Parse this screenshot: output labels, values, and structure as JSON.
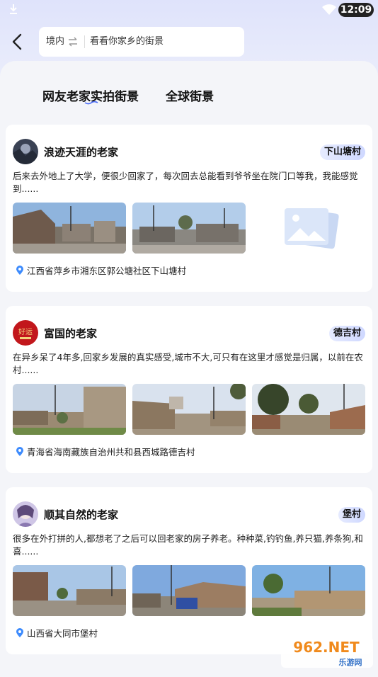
{
  "status_bar": {
    "time": "12:09"
  },
  "search": {
    "region": "境内",
    "query": "看看你家乡的街景"
  },
  "tabs": [
    {
      "label": "网友老家实拍街景"
    },
    {
      "label": "全球街景"
    }
  ],
  "cards": [
    {
      "title": "浪迹天涯的老家",
      "tag": "下山塘村",
      "description": "后来去外地上了大学，便很少回家了，每次回去总能看到爷爷坐在院门口等我，我能感觉到......",
      "location": "江西省萍乡市湘东区郭公塘社区下山塘村",
      "photos": [
        "street-photo",
        "street-photo",
        "placeholder-image-icon"
      ]
    },
    {
      "title": "富国的老家",
      "tag": "德吉村",
      "description": "在异乡呆了4年多,回家乡发展的真实感受,城市不大,可只有在这里才感觉是归属，以前在农村......",
      "location": "青海省海南藏族自治州共和县西城路德吉村",
      "avatar_text": "好运",
      "photos": [
        "street-photo",
        "street-photo",
        "street-photo"
      ]
    },
    {
      "title": "顺其自然的老家",
      "tag": "堡村",
      "description": "很多在外打拼的人,都想老了之后可以回老家的房子养老。种种菜,钓钓鱼,养只猫,养条狗,和喜......",
      "location": "山西省大同市堡村",
      "photos": [
        "street-photo",
        "street-photo",
        "street-photo"
      ]
    }
  ],
  "watermark": {
    "text": "962.NET",
    "subtext": "乐游网"
  },
  "colors": {
    "accent": "#4a6cf7",
    "tag_bg": "#dbe2ff",
    "pin": "#3d8bfd"
  }
}
